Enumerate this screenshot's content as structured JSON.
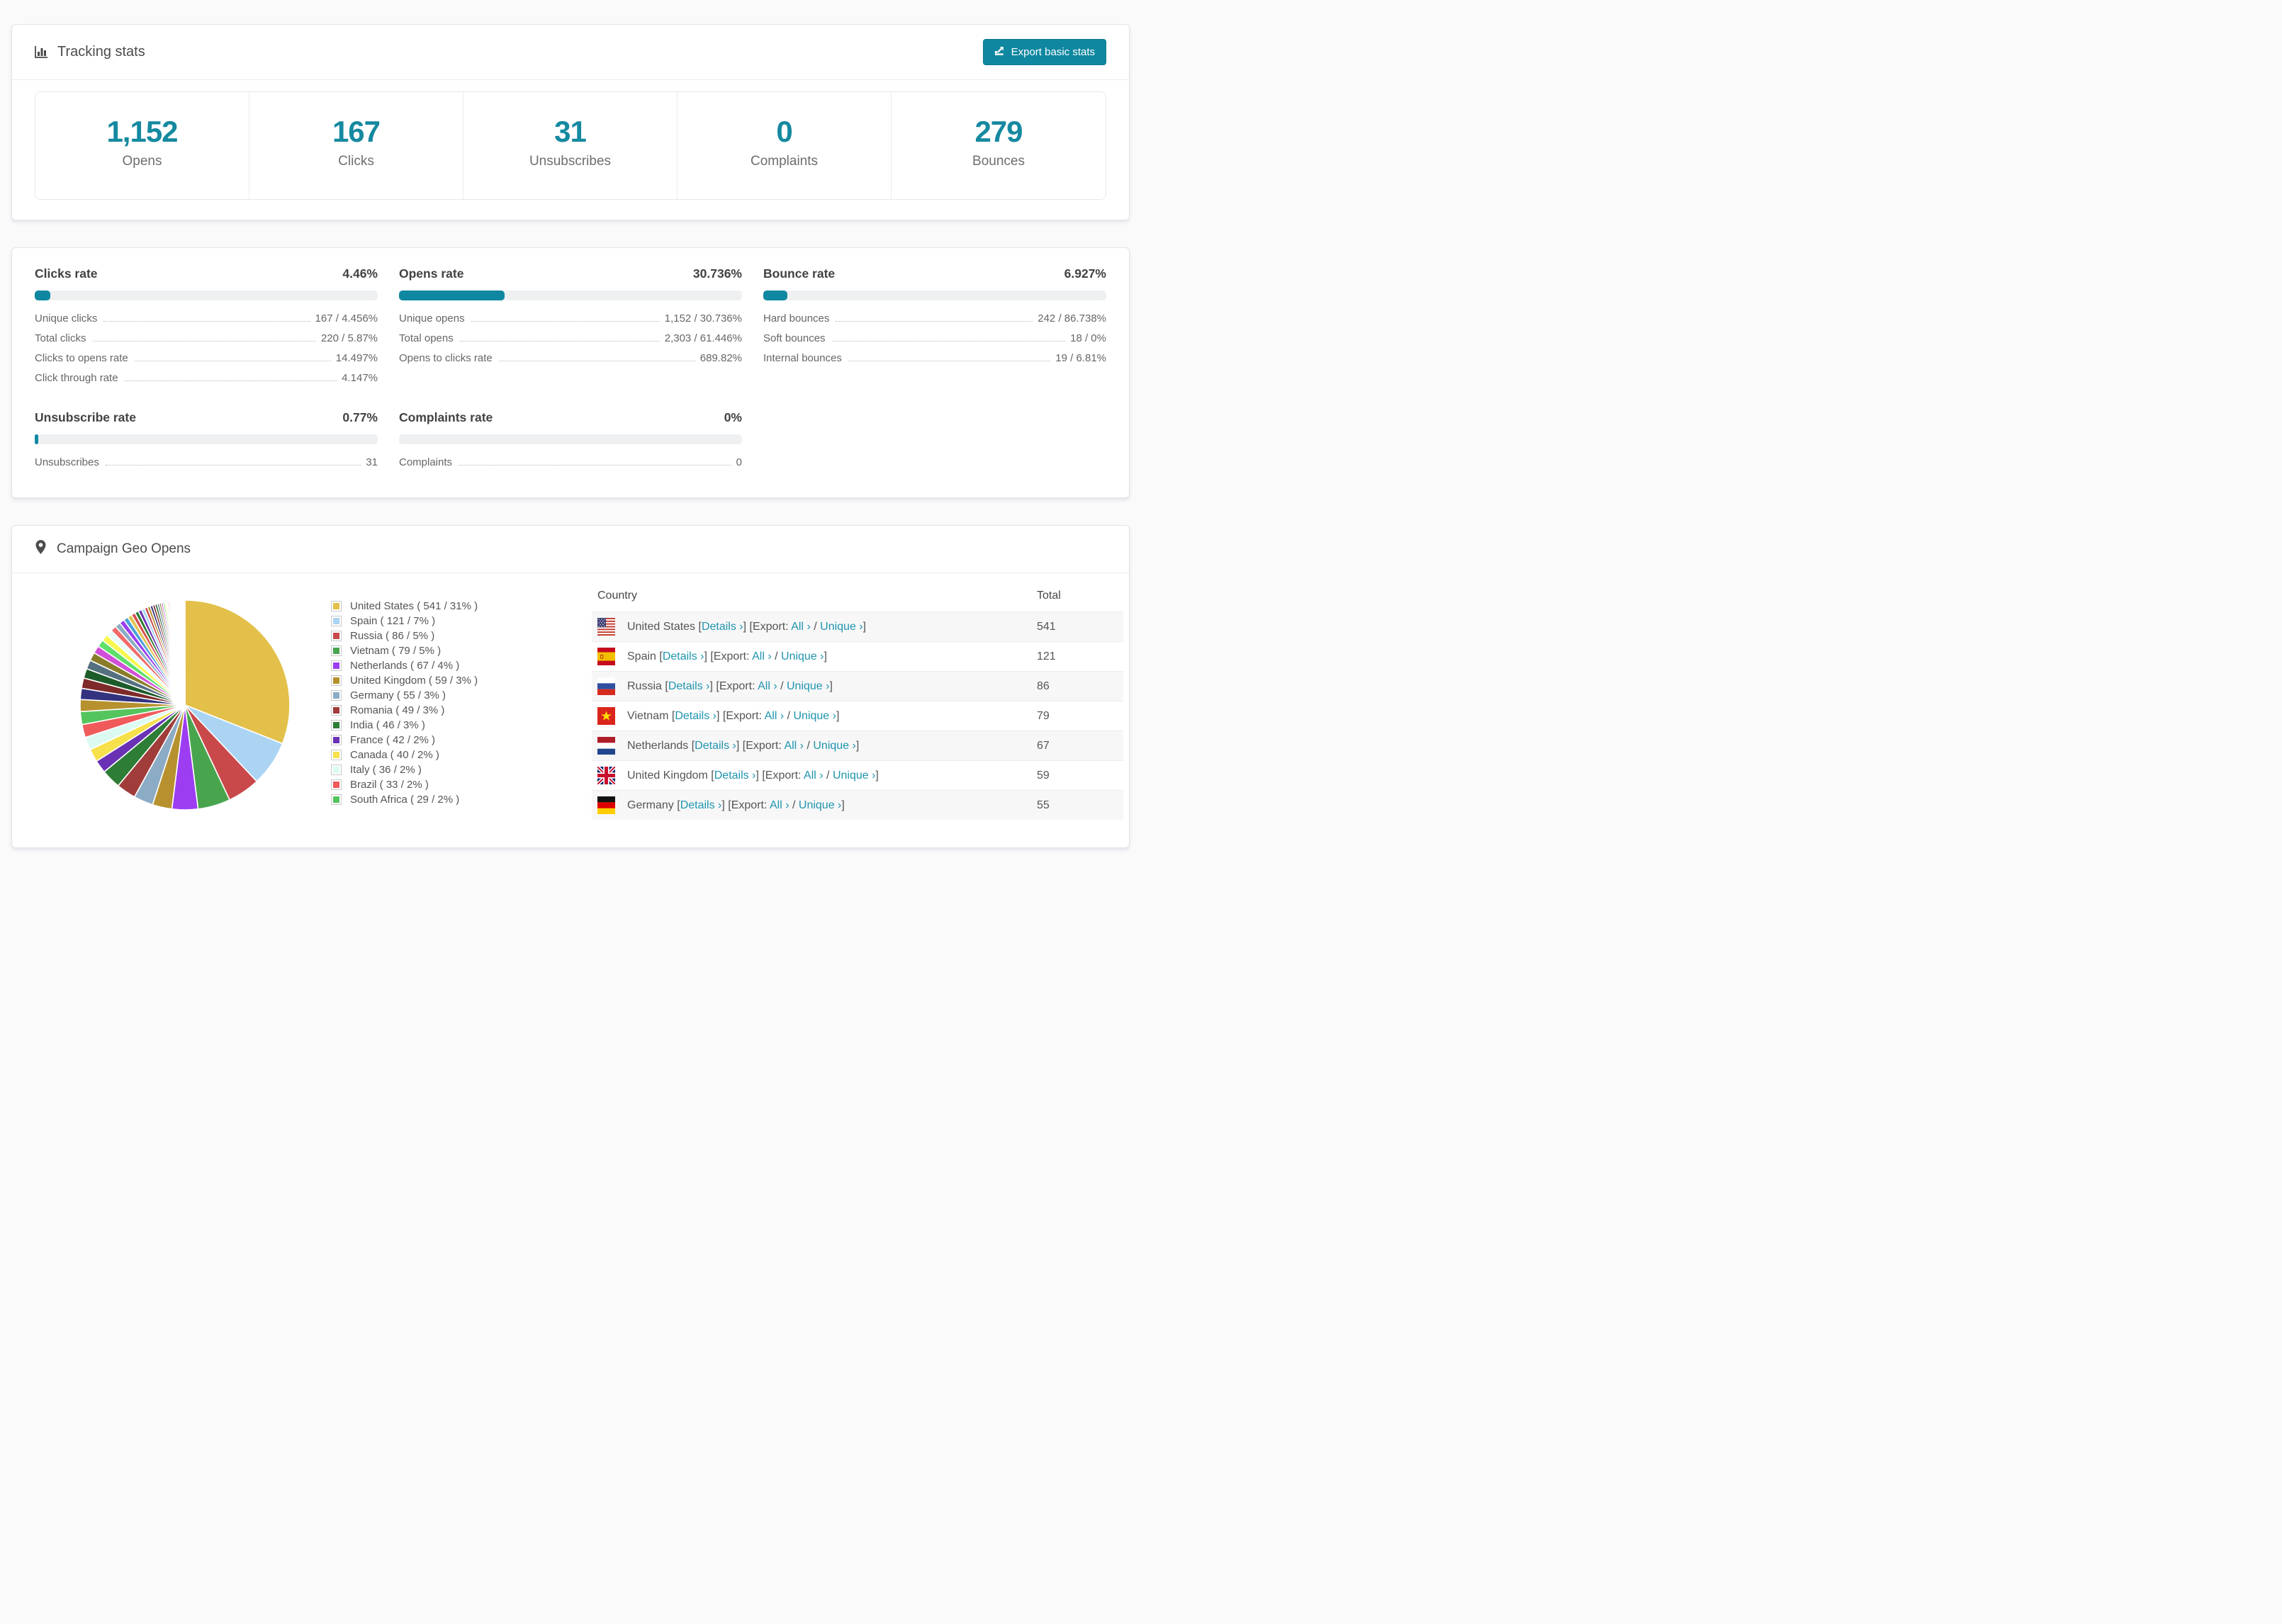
{
  "accent_color": "#0f87a0",
  "link_color": "#1f95ae",
  "number_color": "#1589a0",
  "tracking": {
    "title": "Tracking stats",
    "export_label": "Export basic stats"
  },
  "summary": [
    {
      "value": "1,152",
      "label": "Opens"
    },
    {
      "value": "167",
      "label": "Clicks"
    },
    {
      "value": "31",
      "label": "Unsubscribes"
    },
    {
      "value": "0",
      "label": "Complaints"
    },
    {
      "value": "279",
      "label": "Bounces"
    }
  ],
  "rates": {
    "clicks": {
      "title": "Clicks rate",
      "pct": "4.46%",
      "bar": 4.46,
      "rows": [
        {
          "label": "Unique clicks",
          "value": "167 / 4.456%"
        },
        {
          "label": "Total clicks",
          "value": "220 / 5.87%"
        },
        {
          "label": "Clicks to opens rate",
          "value": "14.497%"
        },
        {
          "label": "Click through rate",
          "value": "4.147%"
        }
      ]
    },
    "opens": {
      "title": "Opens rate",
      "pct": "30.736%",
      "bar": 30.736,
      "rows": [
        {
          "label": "Unique opens",
          "value": "1,152 / 30.736%"
        },
        {
          "label": "Total opens",
          "value": "2,303 / 61.446%"
        },
        {
          "label": "Opens to clicks rate",
          "value": "689.82%"
        }
      ]
    },
    "bounce": {
      "title": "Bounce rate",
      "pct": "6.927%",
      "bar": 6.927,
      "rows": [
        {
          "label": "Hard bounces",
          "value": "242 / 86.738%"
        },
        {
          "label": "Soft bounces",
          "value": "18 / 0%"
        },
        {
          "label": "Internal bounces",
          "value": "19 / 6.81%"
        }
      ]
    },
    "unsubscribe": {
      "title": "Unsubscribe rate",
      "pct": "0.77%",
      "bar": 0.77,
      "rows": [
        {
          "label": "Unsubscribes",
          "value": "31"
        }
      ]
    },
    "complaints": {
      "title": "Complaints rate",
      "pct": "0%",
      "bar": 0,
      "rows": [
        {
          "label": "Complaints",
          "value": "0"
        }
      ]
    }
  },
  "geo": {
    "title": "Campaign Geo Opens",
    "table_headers": {
      "country": "Country",
      "total": "Total"
    },
    "link_words": {
      "open_bracket": "[",
      "close_bracket": "]",
      "details": "Details ›",
      "export": "Export:",
      "all": "All ›",
      "slash": "/",
      "unique": "Unique ›"
    },
    "rows": [
      {
        "country": "United States",
        "flag": "us",
        "total": "541"
      },
      {
        "country": "Spain",
        "flag": "es",
        "total": "121"
      },
      {
        "country": "Russia",
        "flag": "ru",
        "total": "86"
      },
      {
        "country": "Vietnam",
        "flag": "vn",
        "total": "79"
      },
      {
        "country": "Netherlands",
        "flag": "nl",
        "total": "67"
      },
      {
        "country": "United Kingdom",
        "flag": "gb",
        "total": "59"
      },
      {
        "country": "Germany",
        "flag": "de",
        "total": "55"
      }
    ]
  },
  "chart_data": {
    "type": "pie",
    "title": "Campaign Geo Opens",
    "legend_position": "right",
    "start_angle_deg": -90,
    "direction": "clockwise",
    "series": [
      {
        "name": "United States",
        "value": 541,
        "pct": 31,
        "color": "#e3c04a"
      },
      {
        "name": "Spain",
        "value": 121,
        "pct": 7,
        "color": "#abd4f3"
      },
      {
        "name": "Russia",
        "value": 86,
        "pct": 5,
        "color": "#c9494b"
      },
      {
        "name": "Vietnam",
        "value": 79,
        "pct": 5,
        "color": "#49a54d"
      },
      {
        "name": "Netherlands",
        "value": 67,
        "pct": 4,
        "color": "#9c3df2"
      },
      {
        "name": "United Kingdom",
        "value": 59,
        "pct": 3,
        "color": "#b6912e"
      },
      {
        "name": "Germany",
        "value": 55,
        "pct": 3,
        "color": "#8cabc4"
      },
      {
        "name": "Romania",
        "value": 49,
        "pct": 3,
        "color": "#a03c3a"
      },
      {
        "name": "India",
        "value": 46,
        "pct": 3,
        "color": "#2e7d36"
      },
      {
        "name": "France",
        "value": 42,
        "pct": 2,
        "color": "#6a31b5"
      },
      {
        "name": "Canada",
        "value": 40,
        "pct": 2,
        "color": "#f6e04b"
      },
      {
        "name": "Italy",
        "value": 36,
        "pct": 2,
        "color": "#dcfaf2"
      },
      {
        "name": "Brazil",
        "value": 33,
        "pct": 2,
        "color": "#f05a5b"
      },
      {
        "name": "South Africa",
        "value": 29,
        "pct": 2,
        "color": "#54c45d"
      }
    ],
    "other_pct": 26
  }
}
